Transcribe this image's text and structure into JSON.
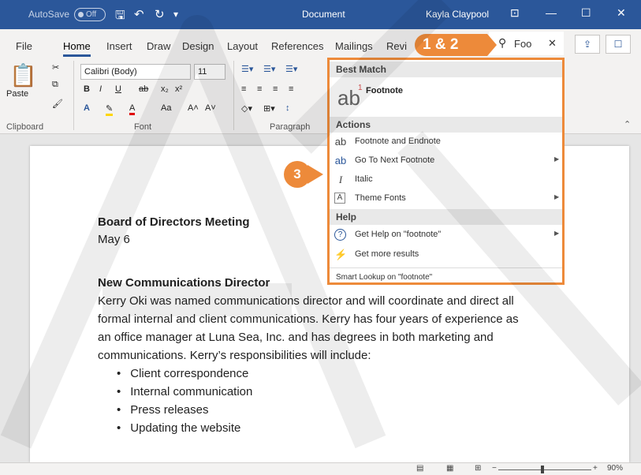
{
  "titlebar": {
    "autosave": "AutoSave",
    "autosave_state": "Off",
    "document_title": "Document",
    "user": "Kayla Claypool",
    "bg": "#2b579a"
  },
  "tabs": [
    "File",
    "Home",
    "Insert",
    "Draw",
    "Design",
    "Layout",
    "References",
    "Mailings",
    "Revi"
  ],
  "search": {
    "value": "Foo"
  },
  "ribbon": {
    "paste": "Paste",
    "font_name": "Calibri (Body)",
    "font_size": "11",
    "groups": {
      "clipboard": "Clipboard",
      "font": "Font",
      "paragraph": "Paragraph"
    }
  },
  "dropdown": {
    "best_match_header": "Best Match",
    "best_match_icon_text": "ab",
    "best_match_sup": "1",
    "best_match_label": "Footnote",
    "actions_header": "Actions",
    "actions": [
      {
        "icon": "ab",
        "label": "Footnote and Endnote"
      },
      {
        "icon": "ab",
        "label": "Go To Next Footnote"
      },
      {
        "icon": "I",
        "label": "Italic"
      },
      {
        "icon": "A",
        "label": "Theme Fonts"
      }
    ],
    "help_header": "Help",
    "help": [
      {
        "icon": "?",
        "label": "Get Help on \"footnote\""
      },
      {
        "icon": "⚡",
        "label": "Get more results"
      }
    ],
    "smart_lookup": "Smart Lookup on \"footnote\"",
    "accent": "#ed8a3a"
  },
  "callouts": {
    "first": "1 & 2",
    "second": "3"
  },
  "document": {
    "heading1": "Board of Directors Meeting",
    "date": "May 6",
    "heading2": "New Communications Director",
    "para": [
      "Kerry Oki was named communications director and will coordinate and direct all",
      "formal internal and client communications. Kerry has four years of experience as",
      "an office manager at Luna Sea, Inc. and has degrees in both marketing and",
      "communications. Kerry’s responsibilities will include:"
    ],
    "bullets": [
      "Client correspondence",
      "Internal communication",
      "Press releases",
      "Updating the website"
    ]
  },
  "status": {
    "zoom": "90%"
  }
}
